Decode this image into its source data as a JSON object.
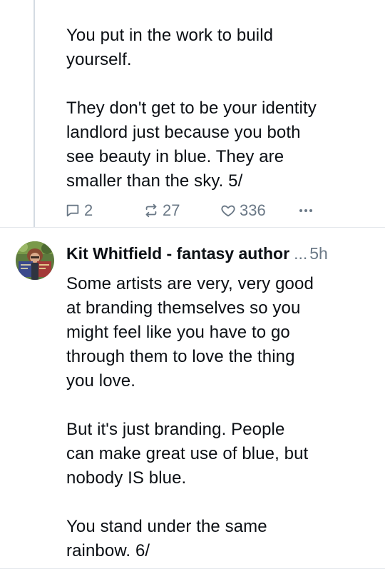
{
  "posts": [
    {
      "text": "You put in the work to build\nyourself.\n\nThey don't get to be your identity\nlandlord just because you both\nsee beauty in blue. They are\nsmaller than the sky. 5/",
      "reply_count": "2",
      "repost_count": "27",
      "like_count": "336"
    },
    {
      "author": "Kit Whitfield - fantasy author",
      "ellipsis": "...",
      "timestamp": "5h",
      "text": "Some artists are very, very good\nat branding themselves so you\nmight feel like you have to go\nthrough them to love the thing\nyou love.\n\nBut it's just branding. People\ncan make great use of blue, but\nnobody IS blue.\n\nYou stand under the same\nrainbow. 6/"
    }
  ],
  "colors": {
    "text": "#0b0f14",
    "muted": "#6a7886",
    "thread_line": "#d4dbe2",
    "divider": "#e4e8ec"
  },
  "icons": [
    "reply-icon",
    "repost-icon",
    "like-icon",
    "more-icon",
    "avatar"
  ]
}
